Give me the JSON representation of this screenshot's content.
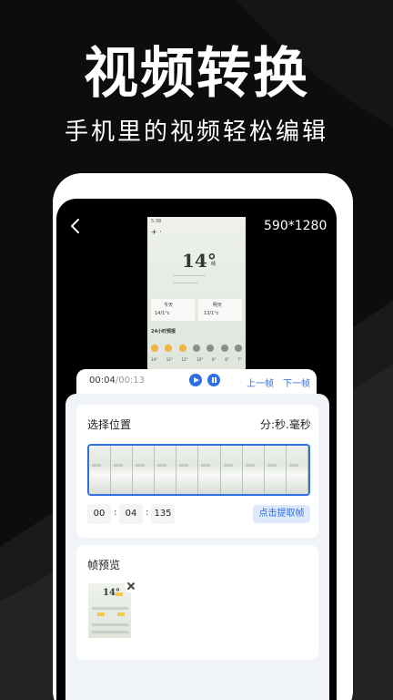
{
  "hero": {
    "title": "视频转换",
    "subtitle": "手机里的视频轻松编辑"
  },
  "toolbar": {
    "dimensions": "590*1280"
  },
  "video_preview": {
    "temperature": "14°",
    "condition": "晴",
    "today_label": "今天",
    "tomorrow_label": "明天",
    "today_range": "14/1°c",
    "tomorrow_range": "13/1°c",
    "forecast_label": "24小时预报",
    "hourly_temps": [
      "14°",
      "12°",
      "12°",
      "10°",
      "9°",
      "8°",
      "7°"
    ]
  },
  "player": {
    "current_time": "00:04",
    "total_time": "00:13",
    "prev_frame_label": "上一帧",
    "next_frame_label": "下一帧"
  },
  "select_position": {
    "label": "选择位置",
    "unit_label": "分:秒.毫秒",
    "minutes": "00",
    "seconds": "04",
    "milliseconds": "135",
    "extract_button": "点击提取帧"
  },
  "frame_preview": {
    "label": "帧预览",
    "thumb_temp": "14°"
  },
  "colors": {
    "accent": "#2f6fe0",
    "sheet_bg": "#f0f3f8"
  }
}
